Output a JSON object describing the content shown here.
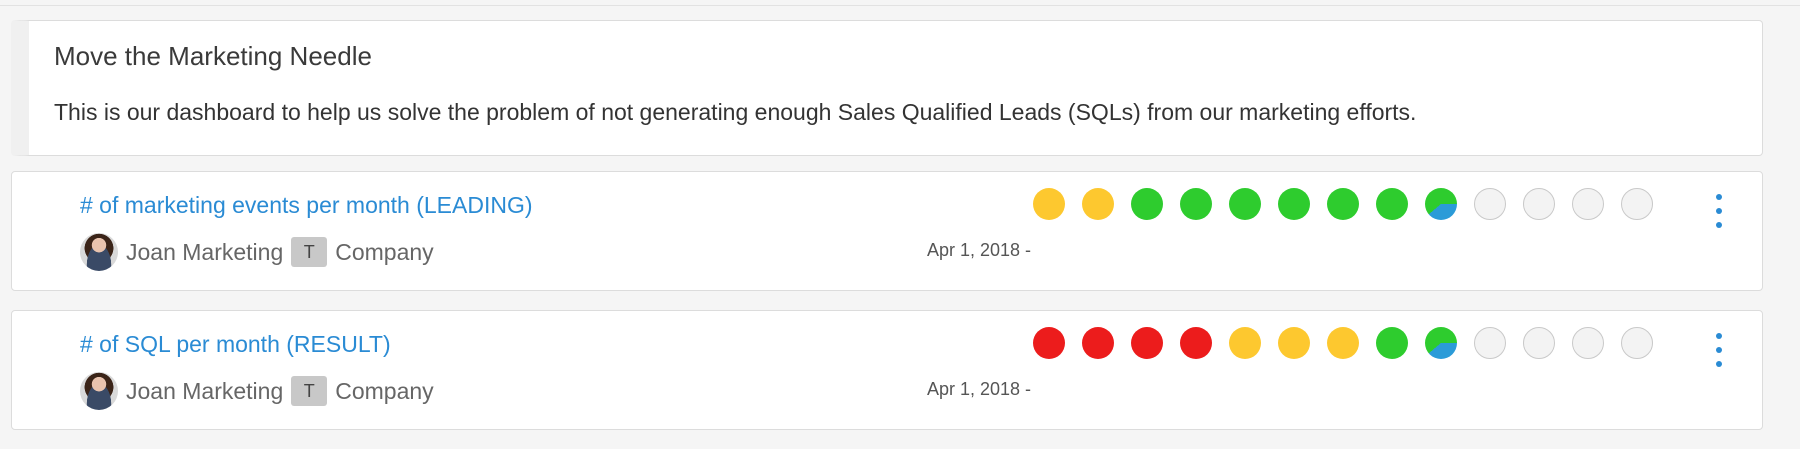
{
  "intro": {
    "title": "Move the Marketing Needle",
    "description": "This is our dashboard to help us solve the problem of not generating enough Sales Qualified Leads (SQLs) from our marketing efforts."
  },
  "metrics": [
    {
      "title": "# of marketing events per month (LEADING)",
      "owner": "Joan Marketing",
      "team_badge": "T",
      "team": "Company",
      "date": "Apr 1, 2018 -",
      "statuses": [
        "yellow",
        "yellow",
        "green",
        "green",
        "green",
        "green",
        "green",
        "green",
        "partial",
        "empty",
        "empty",
        "empty",
        "empty"
      ]
    },
    {
      "title": "# of SQL per month (RESULT)",
      "owner": "Joan Marketing",
      "team_badge": "T",
      "team": "Company",
      "date": "Apr 1, 2018 -",
      "statuses": [
        "red",
        "red",
        "red",
        "red",
        "yellow",
        "yellow",
        "yellow",
        "green",
        "partial",
        "empty",
        "empty",
        "empty",
        "empty"
      ]
    }
  ],
  "colors": {
    "link": "#2a8bd4",
    "yellow": "#fdc82f",
    "green": "#2ecc2e",
    "red": "#ec1c1c",
    "partial_blue": "#2b9bd8"
  },
  "icons": {
    "menu": "more-vertical-icon",
    "avatar": "user-avatar"
  }
}
